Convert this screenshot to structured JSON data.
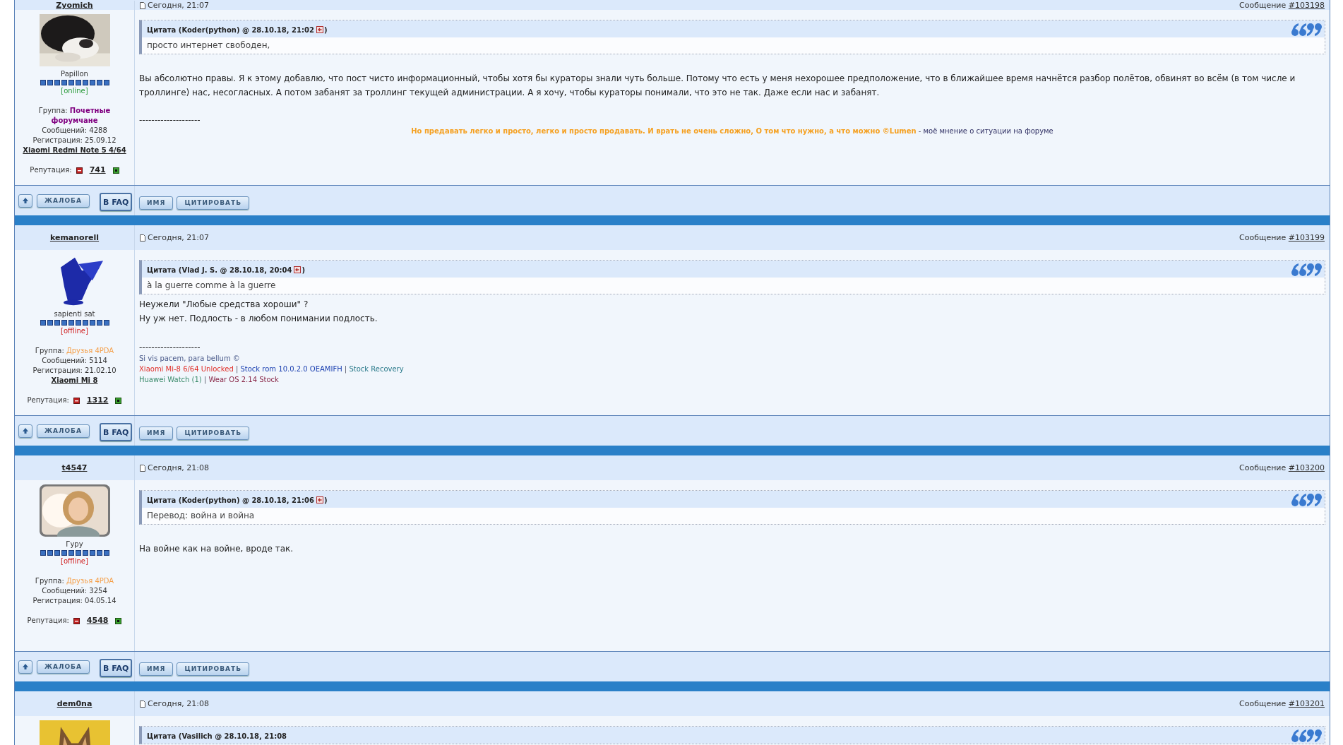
{
  "posts": [
    {
      "author": "Zyomich",
      "time": "Сегодня, 21:07",
      "number_label": "Сообщение",
      "number": "#103198",
      "avatar": {
        "kind": "picture"
      },
      "rank": "Papillon",
      "status": "[online]",
      "online": true,
      "group_label": "Группа:",
      "group": {
        "name": "Почетные форумчане",
        "color": "#800080"
      },
      "messages": "Сообщений: 4288",
      "registration": "Регистрация: 25.09.12",
      "device": "Xiaomi Redmi Note 5 4/64",
      "reputation_label": "Репутация:",
      "reputation": "741",
      "quote": {
        "header": "Цитата (Koder(python) @ 28.10.18, 21:02",
        "close": ")",
        "text": "просто интернет свободен,"
      },
      "body": [
        "Вы абсолютно правы. Я к этому добавлю, что пост чисто информационный, чтобы хотя бы кураторы знали чуть больше. Потому что есть у меня нехорошее предположение, что в ближайшее время начнётся разбор полётов, обвинят во всём (в том числе и троллинге) нас, несогласных. А потом забанят за троллинг текущей администрации. А я хочу, чтобы кураторы понимали, что это не так. Даже если нас и забанят."
      ],
      "signature": {
        "rule": "--------------------",
        "centered": true,
        "lines": [
          [
            {
              "text": "Но предавать легко и просто, легко и просто продавать. И врать не очень сложно, О том что нужно, а что можно ©Lumen",
              "color": "#f5a020",
              "bold": true
            },
            {
              "text": " - ",
              "bold": false
            },
            {
              "text": "моё мнение о ситуации на форуме",
              "color": "#333366",
              "bold": false
            }
          ]
        ]
      },
      "buttons": {
        "report": "ЖАЛОБА",
        "faq": "В FAQ",
        "name": "ИМЯ",
        "quote": "ЦИТИРОВАТЬ"
      }
    },
    {
      "author": "kemanorell",
      "time": "Сегодня, 21:07",
      "number_label": "Сообщение",
      "number": "#103199",
      "avatar": {
        "kind": "picture"
      },
      "rank": "sapienti sat",
      "status": "[offline]",
      "online": false,
      "group_label": "Группа:",
      "group": {
        "name": "Друзья 4PDA",
        "color": "#f5a04a"
      },
      "messages": "Сообщений: 5114",
      "registration": "Регистрация: 21.02.10",
      "device": "Xiaomi Mi 8",
      "reputation_label": "Репутация:",
      "reputation": "1312",
      "quote": {
        "header": "Цитата (Vlad J. S. @ 28.10.18, 20:04",
        "close": ")",
        "text": "à la guerre comme à la guerre"
      },
      "body": [
        "Неужели \"Любые средства хороши\" ?",
        "Ну уж нет. Подлость - в любом понимании подлость."
      ],
      "signature": {
        "rule": "--------------------",
        "centered": false,
        "lines": [
          [
            {
              "text": "Si vis pacem, para bellum ©",
              "color": "#4a5a8a",
              "bold": false
            }
          ],
          [
            {
              "text": "Xiaomi Mi-8 6/64 Unlocked",
              "color": "#e0302a",
              "bold": false
            },
            {
              "text": " | ",
              "bold": false
            },
            {
              "text": "Stock rom 10.0.2.0 OEAMIFH",
              "color": "#1a3fb0",
              "bold": false
            },
            {
              "text": " | ",
              "bold": false
            },
            {
              "text": "Stock Recovery",
              "color": "#2a7a8a",
              "bold": false
            }
          ],
          [
            {
              "text": "Huawei Watch (1)",
              "color": "#3a8a6a",
              "bold": false
            },
            {
              "text": " | ",
              "bold": false
            },
            {
              "text": "Wear OS 2.14 Stock",
              "color": "#8a2a4a",
              "bold": false
            }
          ]
        ]
      },
      "buttons": {
        "report": "ЖАЛОБА",
        "faq": "В FAQ",
        "name": "ИМЯ",
        "quote": "ЦИТИРОВАТЬ"
      }
    },
    {
      "author": "t4547",
      "time": "Сегодня, 21:08",
      "number_label": "Сообщение",
      "number": "#103200",
      "avatar": {
        "kind": "picture"
      },
      "rank": "Гуру",
      "status": "[offline]",
      "online": false,
      "group_label": "Группа:",
      "group": {
        "name": "Друзья 4PDA",
        "color": "#f5a04a"
      },
      "messages": "Сообщений: 3254",
      "registration": "Регистрация: 04.05.14",
      "reputation_label": "Репутация:",
      "reputation": "4548",
      "quote": {
        "header": "Цитата (Koder(python) @ 28.10.18, 21:06",
        "close": ")",
        "text": "Перевод: война и война"
      },
      "body": [
        "На войне как на войне, вроде так."
      ],
      "buttons": {
        "report": "ЖАЛОБА",
        "faq": "В FAQ",
        "name": "ИМЯ",
        "quote": "ЦИТИРОВАТЬ"
      }
    },
    {
      "author": "dem0na",
      "time": "Сегодня, 21:08",
      "number_label": "Сообщение",
      "number": "#103201",
      "avatar": {
        "kind": "picture"
      },
      "quote": {
        "header": "Цитата (Vasilich @ 28.10.18, 21:08"
      }
    }
  ]
}
